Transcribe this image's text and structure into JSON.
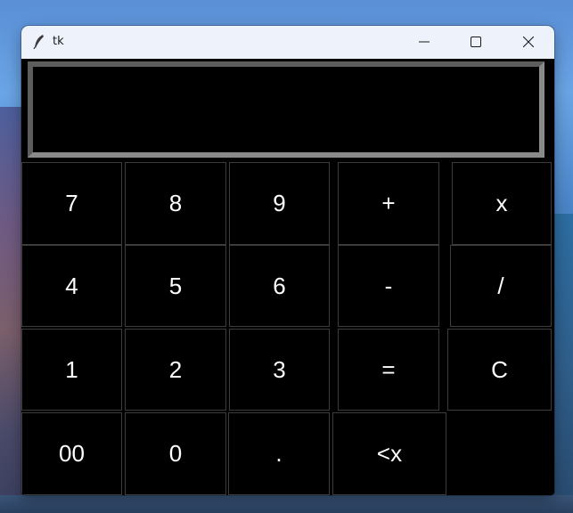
{
  "window": {
    "title": "tk",
    "title_icon": "feather-icon",
    "controls": {
      "minimize": "minimize-icon",
      "maximize": "maximize-icon",
      "close": "close-icon"
    }
  },
  "display": {
    "value": ""
  },
  "keypad": {
    "row1": [
      "7",
      "8",
      "9",
      "+",
      "x"
    ],
    "row2": [
      "4",
      "5",
      "6",
      "-",
      "/"
    ],
    "row3": [
      "1",
      "2",
      "3",
      "=",
      "C"
    ],
    "row4": [
      "00",
      "0",
      ".",
      "<x"
    ]
  },
  "colors": {
    "key_background": "#000000",
    "key_text": "#ffffff",
    "key_border": "#3c3c3c",
    "titlebar": "#eef2fb"
  }
}
